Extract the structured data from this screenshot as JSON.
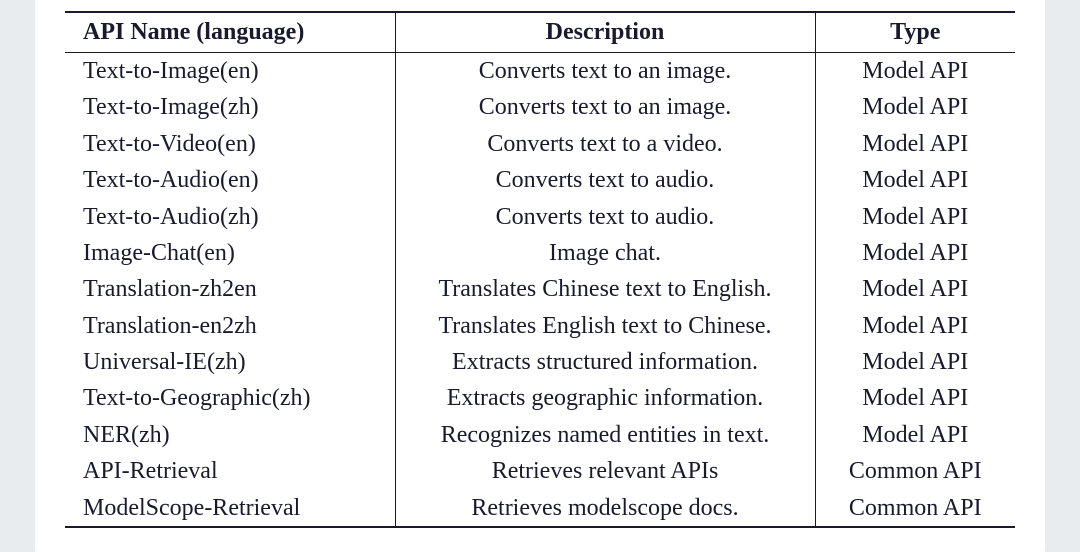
{
  "table": {
    "headers": [
      "API Name (language)",
      "Description",
      "Type"
    ],
    "rows": [
      {
        "name": "Text-to-Image(en)",
        "desc": "Converts text to an image.",
        "type": "Model API"
      },
      {
        "name": "Text-to-Image(zh)",
        "desc": "Converts text to an image.",
        "type": "Model API"
      },
      {
        "name": "Text-to-Video(en)",
        "desc": "Converts text to a video.",
        "type": "Model API"
      },
      {
        "name": "Text-to-Audio(en)",
        "desc": "Converts text to audio.",
        "type": "Model API"
      },
      {
        "name": "Text-to-Audio(zh)",
        "desc": "Converts text to audio.",
        "type": "Model API"
      },
      {
        "name": "Image-Chat(en)",
        "desc": "Image chat.",
        "type": "Model API"
      },
      {
        "name": "Translation-zh2en",
        "desc": "Translates Chinese text to English.",
        "type": "Model API"
      },
      {
        "name": "Translation-en2zh",
        "desc": "Translates English text to Chinese.",
        "type": "Model API"
      },
      {
        "name": "Universal-IE(zh)",
        "desc": "Extracts structured information.",
        "type": "Model API"
      },
      {
        "name": "Text-to-Geographic(zh)",
        "desc": "Extracts geographic information.",
        "type": "Model API"
      },
      {
        "name": "NER(zh)",
        "desc": "Recognizes named entities in text.",
        "type": "Model API"
      },
      {
        "name": "API-Retrieval",
        "desc": "Retrieves relevant APIs",
        "type": "Common API"
      },
      {
        "name": "ModelScope-Retrieval",
        "desc": "Retrieves modelscope docs.",
        "type": "Common API"
      }
    ]
  }
}
